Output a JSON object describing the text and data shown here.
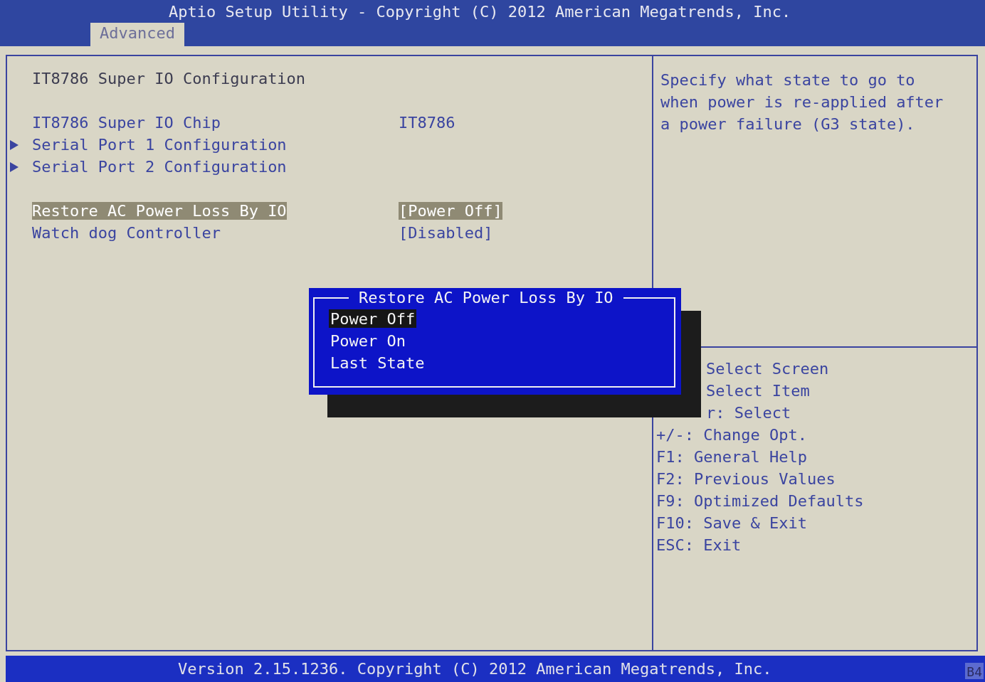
{
  "header": {
    "title": "Aptio Setup Utility - Copyright (C) 2012 American Megatrends, Inc.",
    "tabs": [
      {
        "label": "Advanced",
        "selected": true
      }
    ]
  },
  "settings": {
    "sections": [
      {
        "items": [
          {
            "kind": "heading",
            "label": "IT8786 Super IO Configuration",
            "selected": false
          }
        ]
      },
      {
        "items": [
          {
            "kind": "info",
            "label": "IT8786 Super IO Chip",
            "value": "IT8786",
            "selected": false
          },
          {
            "kind": "submenu",
            "label": "Serial Port 1 Configuration",
            "selected": false
          },
          {
            "kind": "submenu",
            "label": "Serial Port 2 Configuration",
            "selected": false
          }
        ]
      },
      {
        "items": [
          {
            "kind": "option",
            "label": "Restore AC Power Loss By IO",
            "value": "[Power Off]",
            "selected": true
          },
          {
            "kind": "option",
            "label": "Watch dog Controller",
            "value": "[Disabled]",
            "selected": false
          }
        ]
      }
    ]
  },
  "popup": {
    "title": "Restore AC Power Loss By IO",
    "options": [
      {
        "label": "Power Off",
        "selected": true
      },
      {
        "label": "Power On",
        "selected": false
      },
      {
        "label": "Last State",
        "selected": false
      }
    ]
  },
  "help": {
    "description": "Specify what state to go to when power is re-applied after a power failure (G3 state).",
    "hints": [
      {
        "text": "Select Screen",
        "partly_hidden": true
      },
      {
        "text": "Select Item",
        "partly_hidden": true
      },
      {
        "text": "r: Select",
        "partly_hidden": true
      },
      {
        "text": "+/-: Change Opt.",
        "partly_hidden": false
      },
      {
        "text": "F1: General Help",
        "partly_hidden": false
      },
      {
        "text": "F2: Previous Values",
        "partly_hidden": false
      },
      {
        "text": "F9: Optimized Defaults",
        "partly_hidden": false
      },
      {
        "text": "F10: Save & Exit",
        "partly_hidden": false
      },
      {
        "text": "ESC: Exit",
        "partly_hidden": false
      }
    ]
  },
  "footer": {
    "version": "Version 2.15.1236. Copyright (C) 2012 American Megatrends, Inc.",
    "badge": "B4"
  }
}
